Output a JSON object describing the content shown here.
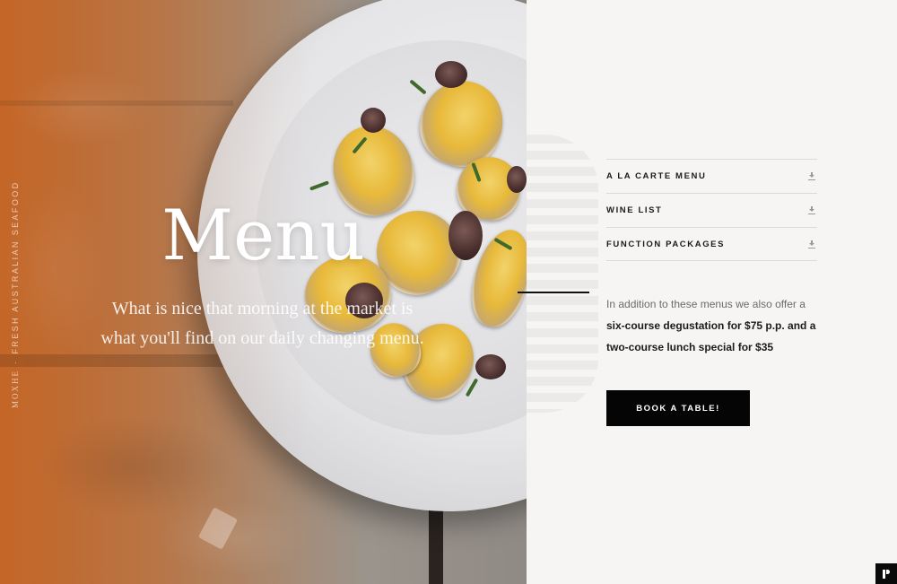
{
  "hero": {
    "brand": "MOXHE",
    "separator": "·",
    "tagline": "FRESH AUSTRALIAN SEAFOOD",
    "title": "Menu",
    "subtitle": "What is nice that morning at the market is what you'll find on our daily changing menu."
  },
  "menus": [
    {
      "label": "A LA CARTE MENU",
      "icon": "download-icon"
    },
    {
      "label": "WINE LIST",
      "icon": "download-icon"
    },
    {
      "label": "FUNCTION PACKAGES",
      "icon": "download-icon"
    }
  ],
  "offer": {
    "intro": "In addition to these menus we also offer a",
    "highlight": "six-course degustation for $75 p.p. and a two-course lunch special for $35"
  },
  "cta": {
    "label": "BOOK A TABLE!"
  },
  "colors": {
    "accent": "#c96a2a",
    "button": "#050505",
    "panel_bg": "#f6f5f3"
  }
}
